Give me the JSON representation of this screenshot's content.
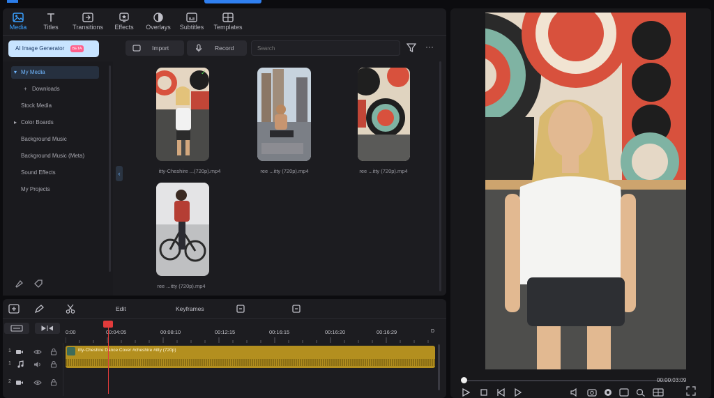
{
  "tabs": [
    {
      "label": "Media",
      "icon": "media-icon",
      "active": true
    },
    {
      "label": "Titles",
      "icon": "titles-icon"
    },
    {
      "label": "Transitions",
      "icon": "transitions-icon"
    },
    {
      "label": "Effects",
      "icon": "effects-icon"
    },
    {
      "label": "Overlays",
      "icon": "overlays-icon"
    },
    {
      "label": "Subtitles",
      "icon": "subtitles-icon"
    },
    {
      "label": "Templates",
      "icon": "templates-icon"
    }
  ],
  "ai_generator": {
    "label": "AI Image Generator",
    "badge": "BETA"
  },
  "toolbar": {
    "import_label": "Import",
    "record_label": "Record",
    "search_placeholder": "Search"
  },
  "nav": [
    {
      "label": "My Media",
      "active": true,
      "arrow": "▾"
    },
    {
      "label": "Downloads",
      "arrow": "+"
    },
    {
      "label": "Stock Media"
    },
    {
      "label": "Color Boards",
      "arrow": "▸"
    },
    {
      "label": "Background Music"
    },
    {
      "label": "Background Music (Meta)"
    },
    {
      "label": "Sound Effects"
    },
    {
      "label": "My Projects"
    }
  ],
  "media": [
    {
      "name": "itty-Cheshire ...(720p).mp4"
    },
    {
      "name": "ree ...itty (720p).mp4"
    },
    {
      "name": "ree ...itty (720p).mp4"
    },
    {
      "name": "ree ...itty (720p).mp4"
    }
  ],
  "timeline_toolbar": {
    "edit_label": "Edit",
    "keyframes_label": "Keyframes"
  },
  "ruler": [
    "0:00",
    "00:04:05",
    "00:08:10",
    "00:12:15",
    "00:16:15",
    "00:16:20",
    "00:16:29"
  ],
  "clip_label": "itty-Cheshire Dance Cover #cheshire #itty (720p)",
  "tracks": [
    {
      "number": "1",
      "type": "video-icon"
    },
    {
      "number": "1",
      "type": "music-icon"
    },
    {
      "number": "2",
      "type": "video-icon"
    }
  ],
  "preview": {
    "timecode": "00:00:03:09",
    "progress": 0.0
  },
  "colors": {
    "accent": "#3aa0ff",
    "clip": "#b38f1f",
    "playhead": "#e23b3b"
  }
}
